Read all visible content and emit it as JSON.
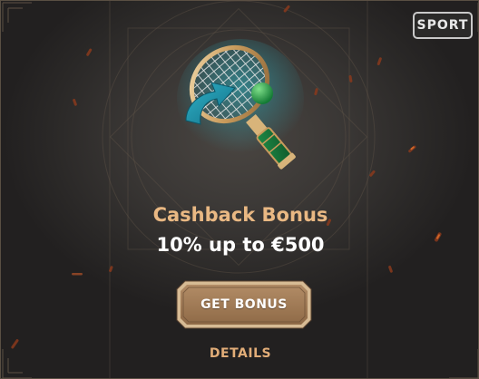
{
  "badge": {
    "label": "SPORT"
  },
  "offer": {
    "title": "Cashback Bonus",
    "subtitle": "10% up to €500"
  },
  "actions": {
    "primary_label": "GET BONUS",
    "secondary_label": "DETAILS"
  },
  "illustration": {
    "icon": "tennis-racket-icon"
  },
  "colors": {
    "title": "#e9b883",
    "subtitle": "#ffffff",
    "button": "#a27b57",
    "details": "#e2ad78",
    "background": "#3a3735",
    "badge_border": "#c9c9c9"
  }
}
